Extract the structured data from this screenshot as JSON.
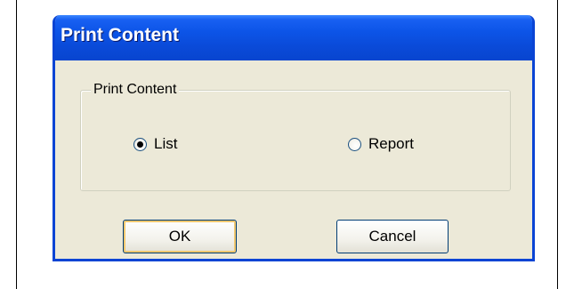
{
  "dialog": {
    "title": "Print Content",
    "group": {
      "label": "Print Content",
      "options": [
        {
          "label": "List",
          "selected": true
        },
        {
          "label": "Report",
          "selected": false
        }
      ]
    },
    "buttons": {
      "ok_label": "OK",
      "cancel_label": "Cancel"
    }
  },
  "colors": {
    "titlebar": "#0a4ad8",
    "dialog_bg": "#ece9d8",
    "button_border": "#003c74"
  }
}
